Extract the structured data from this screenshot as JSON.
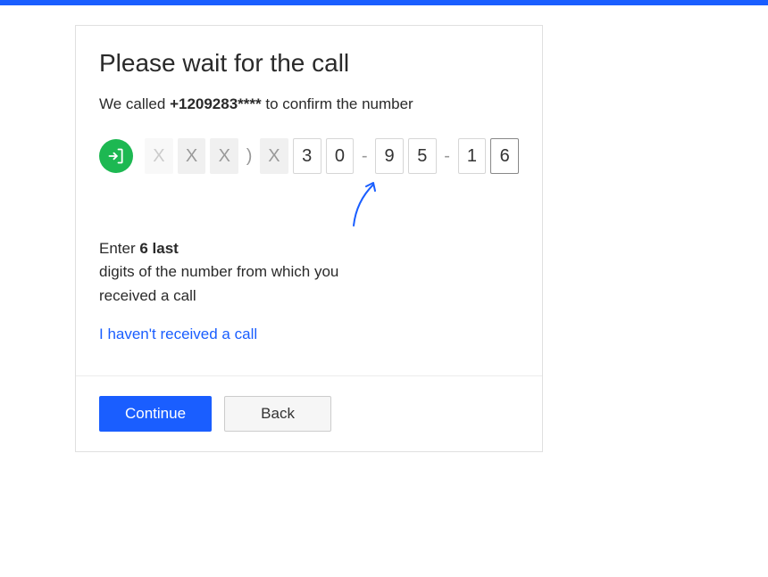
{
  "header": {
    "title": "Please wait for the call",
    "called_prefix": "We called ",
    "called_number": "+1209283****",
    "called_suffix": " to confirm the number"
  },
  "digits": {
    "masked": [
      "X",
      "X",
      "X",
      "X"
    ],
    "paren": ")",
    "entered": [
      "3",
      "0",
      "9",
      "5",
      "1",
      "6"
    ],
    "sep": "-"
  },
  "instructions": {
    "enter_prefix": "Enter ",
    "bold_part": "6 last",
    "line2": "digits of the number from which you received a call"
  },
  "links": {
    "no_call": "I haven't received a call"
  },
  "buttons": {
    "continue": "Continue",
    "back": "Back"
  }
}
